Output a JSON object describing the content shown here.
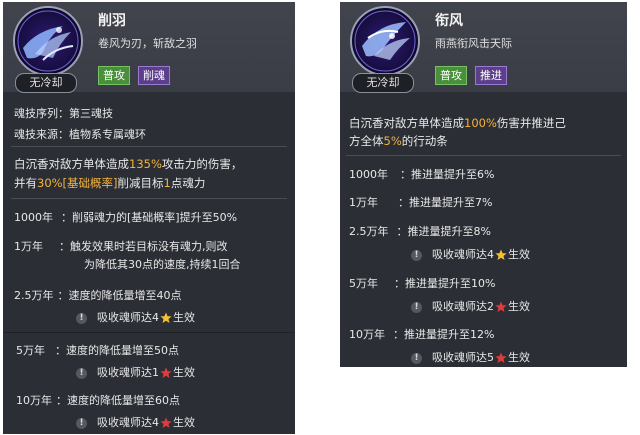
{
  "left": {
    "title": "削羽",
    "subtitle": "卷风为刃，斩敌之羽",
    "badge": "无冷却",
    "tags": [
      "普攻",
      "削魂"
    ],
    "seq_label": "魂技序列：",
    "seq_value": "第三魂技",
    "src_label": "魂技来源：",
    "src_value": "植物系专属魂环",
    "desc1_a": "白沉香对敌方单体造成",
    "desc1_b": "135%",
    "desc1_c": "攻击力的伤害，",
    "desc2_a": "并有",
    "desc2_b": "30%[基础概率]",
    "desc2_c": "削减目标",
    "desc2_d": "1",
    "desc2_e": "点魂力",
    "u1_year": "1000年",
    "u1_text": "：削弱魂力的[基础概率]提升至50%",
    "u2_year": "1万年",
    "u2_text1": "：触发效果时若目标没有魂力,则改",
    "u2_text2": "为降低其30点的速度,持续1回合",
    "u3_year": "2.5万年",
    "u3_text": "：速度的降低量增至40点",
    "u3_req_a": "吸收魂师达4",
    "u3_req_b": "生效",
    "u4_year": "5万年",
    "u4_text": "：速度的降低量增至50点",
    "u4_req_a": "吸收魂师达1",
    "u4_req_b": "生效",
    "u5_year": "10万年",
    "u5_text": "：速度的降低量增至60点",
    "u5_req_a": "吸收魂师达4",
    "u5_req_b": "生效",
    "colors": {
      "gold_star": "#f2c230",
      "red_star": "#e23b3b"
    }
  },
  "right": {
    "title": "衔风",
    "subtitle": "雨燕衔风击天际",
    "badge": "无冷却",
    "tags": [
      "普攻",
      "推进"
    ],
    "desc1_a": "白沉香对敌方单体造成",
    "desc1_b": "100%",
    "desc1_c": "伤害并推进己",
    "desc2_a": "方全体",
    "desc2_b": "5%",
    "desc2_c": "的行动条",
    "u1_year": "1000年",
    "u1_text": "：推进量提升至6%",
    "u2_year": "1万年",
    "u2_text": "：推进量提升至7%",
    "u3_year": "2.5万年",
    "u3_text": "：推进量提升至8%",
    "u3_req_a": "吸收魂师达4",
    "u3_req_b": "生效",
    "u4_year": "5万年",
    "u4_text": "：推进量提升至10%",
    "u4_req_a": "吸收魂师达2",
    "u4_req_b": "生效",
    "u5_year": "10万年",
    "u5_text": "：推进量提升至12%",
    "u5_req_a": "吸收魂师达5",
    "u5_req_b": "生效"
  }
}
